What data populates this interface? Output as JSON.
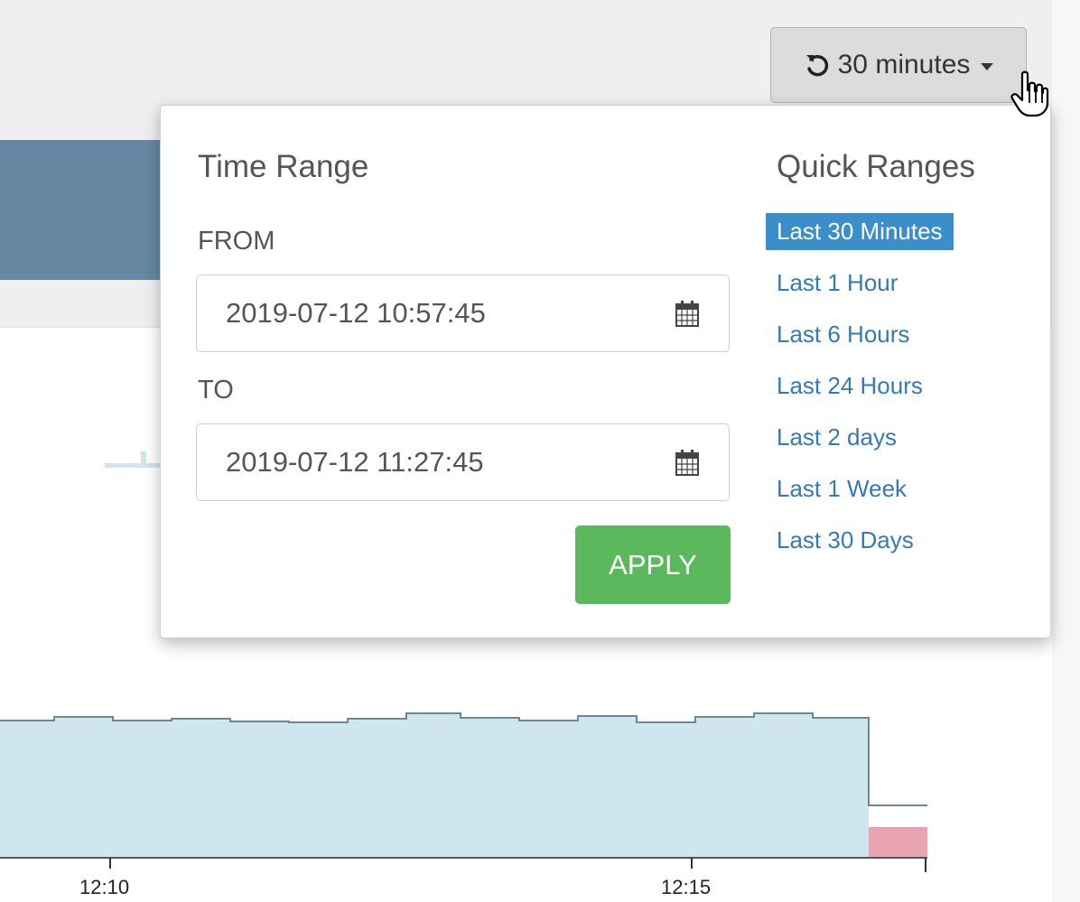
{
  "range_button": {
    "label": "30 minutes"
  },
  "time_range": {
    "title": "Time Range",
    "from_label": "FROM",
    "from_value": "2019-07-12 10:57:45",
    "to_label": "TO",
    "to_value": "2019-07-12 11:27:45",
    "apply_label": "APPLY"
  },
  "quick_ranges": {
    "title": "Quick Ranges",
    "items": [
      {
        "label": "Last 30 Minutes",
        "active": true
      },
      {
        "label": "Last 1 Hour"
      },
      {
        "label": "Last 6 Hours"
      },
      {
        "label": "Last 24 Hours"
      },
      {
        "label": "Last 2 days"
      },
      {
        "label": "Last 1 Week"
      },
      {
        "label": "Last 30 Days"
      }
    ]
  },
  "background_chart": {
    "ticks": [
      "12:10",
      "12:15"
    ],
    "fill_color": "#cfe6ee",
    "line_color": "#6a8a96",
    "alert_color": "#e8a4b1"
  },
  "icons": {
    "refresh": "refresh-icon",
    "calendar": "calendar-icon",
    "caret": "caret-down-icon",
    "cursor": "hand-pointer-icon"
  },
  "colors": {
    "primary_link": "#337ab7",
    "active_bg": "#3a8fcb",
    "apply_bg": "#5cb85c",
    "panel_blue": "#6688a3"
  }
}
